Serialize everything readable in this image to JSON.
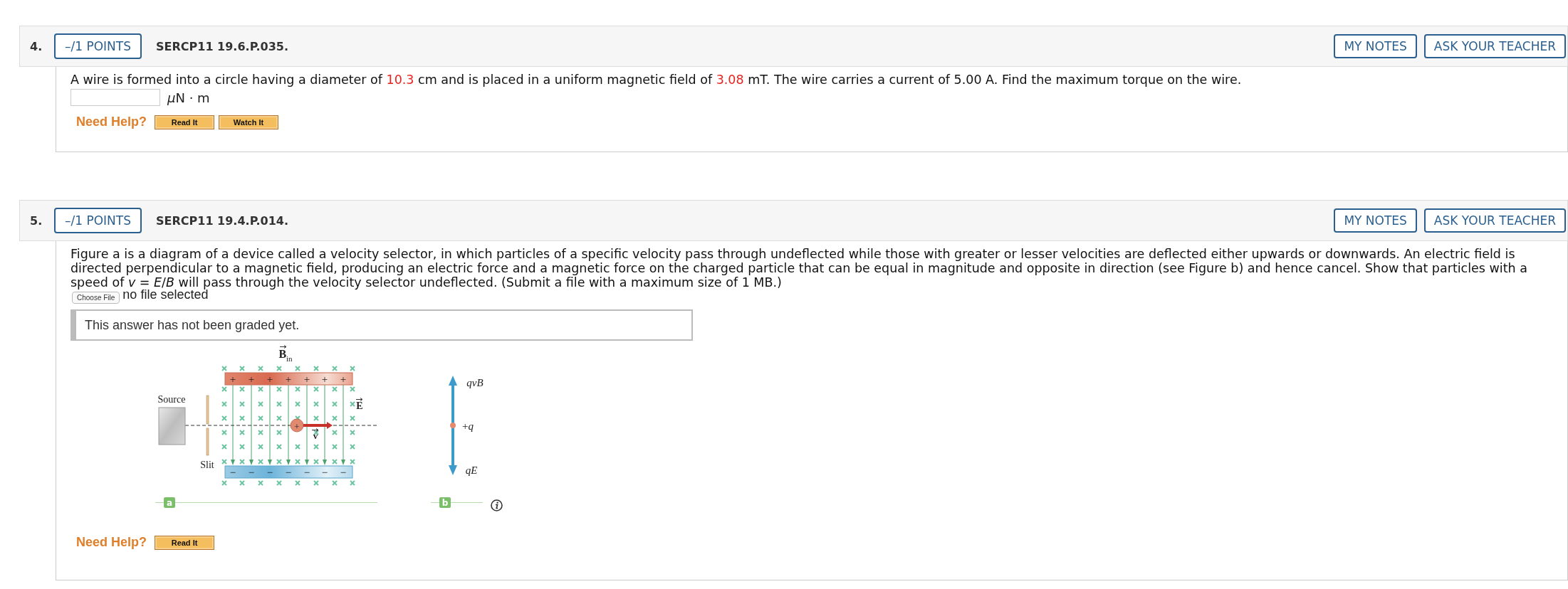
{
  "questions": [
    {
      "number": "4.",
      "points": "–/1 POINTS",
      "code": "SERCP11 19.6.P.035.",
      "actions": [
        "MY NOTES",
        "ASK YOUR TEACHER"
      ],
      "prompt": [
        {
          "kind": "plain",
          "text": "A wire is formed into a circle having a diameter of "
        },
        {
          "kind": "value",
          "text": "10.3"
        },
        {
          "kind": "plain",
          "text": " cm and is placed in a uniform magnetic field of "
        },
        {
          "kind": "value",
          "text": "3.08"
        },
        {
          "kind": "plain",
          "text": " mT. The wire carries a current of 5.00 A. Find the maximum torque on the wire."
        }
      ],
      "answer": {
        "kind": "number",
        "unit_prefix": "μ",
        "unit": "N · m"
      },
      "help": {
        "label": "Need Help?",
        "buttons": [
          "Read It",
          "Watch It"
        ]
      }
    },
    {
      "number": "5.",
      "points": "–/1 POINTS",
      "code": "SERCP11 19.4.P.014.",
      "actions": [
        "MY NOTES",
        "ASK YOUR TEACHER"
      ],
      "prompt": [
        {
          "kind": "plain",
          "text": "Figure a is a diagram of a device called a velocity selector, in which particles of a specific velocity pass through undeflected while those with greater or lesser velocities are deflected either upwards or downwards. An electric field is directed perpendicular to a magnetic field, producing an electric force and a magnetic force on the charged particle that can be equal in magnitude and opposite in direction (see Figure b) and hence cancel. Show that particles with a speed of *v* = *E*/*B* will pass through the velocity selector undeflected. (Submit a file with a maximum size of 1 MB.)"
        }
      ],
      "answer": {
        "kind": "file",
        "button": "Choose File",
        "status": "no file selected"
      },
      "grading": "This answer has not been graded yet.",
      "figure": {
        "field_label": "B",
        "field_subscript": "in",
        "top_signs": [
          "+",
          "+",
          "+",
          "+",
          "+",
          "+",
          "+"
        ],
        "bottom_signs": [
          "−",
          "−",
          "−",
          "−",
          "−",
          "−",
          "−"
        ],
        "particle_sign": "+",
        "source_label": "Source",
        "slit_label": "Slit",
        "velocity_label": "v",
        "efield_label": "E",
        "force_up": "qvB",
        "charge": "+*q*",
        "force_down": "qE",
        "captions": [
          "a",
          "b"
        ]
      },
      "help": {
        "label": "Need Help?",
        "buttons": [
          "Read It"
        ]
      }
    }
  ]
}
